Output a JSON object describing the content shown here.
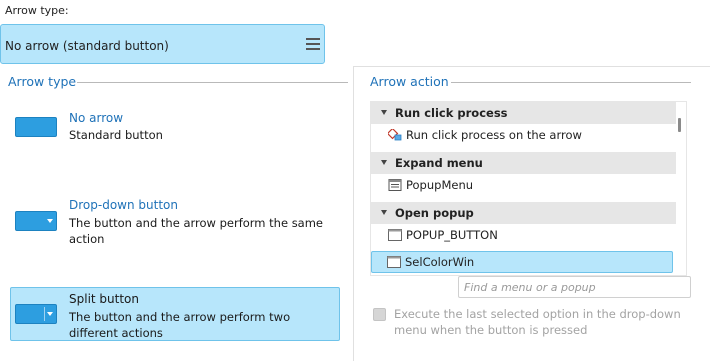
{
  "arrow_type_field": {
    "label": "Arrow type:",
    "value": "No arrow (standard button)",
    "menu_icon": "hamburger-menu-icon"
  },
  "arrow_type_group": {
    "title": "Arrow type",
    "options": [
      {
        "title": "No arrow",
        "description": "Standard button",
        "selected": false
      },
      {
        "title": "Drop-down button",
        "description": "The button and the arrow perform the same action",
        "selected": false
      },
      {
        "title": "Split button",
        "description": "The button and the arrow perform two different actions",
        "selected": true
      }
    ]
  },
  "arrow_action_group": {
    "title": "Arrow action",
    "sections": [
      {
        "label": "Run click process",
        "items": [
          {
            "label": "Run click process on the arrow",
            "icon": "process-icon"
          }
        ]
      },
      {
        "label": "Expand menu",
        "items": [
          {
            "label": "PopupMenu",
            "icon": "menu-icon"
          }
        ]
      },
      {
        "label": "Open popup",
        "items": [
          {
            "label": "POPUP_BUTTON",
            "icon": "window-icon"
          },
          {
            "label": "SelColorWin",
            "icon": "window-icon"
          }
        ]
      }
    ],
    "selected_item": "SelColorWin",
    "search": {
      "placeholder": "Find a menu or a popup",
      "value": ""
    },
    "checkbox": {
      "label": "Execute the last selected option in the drop-down menu when the button is pressed",
      "checked": false,
      "enabled": false
    }
  },
  "colors": {
    "accent": "#1f72b8",
    "selection_bg": "#b7e6fb",
    "selection_border": "#6fc3ea",
    "button_icon": "#2d9ee0"
  }
}
